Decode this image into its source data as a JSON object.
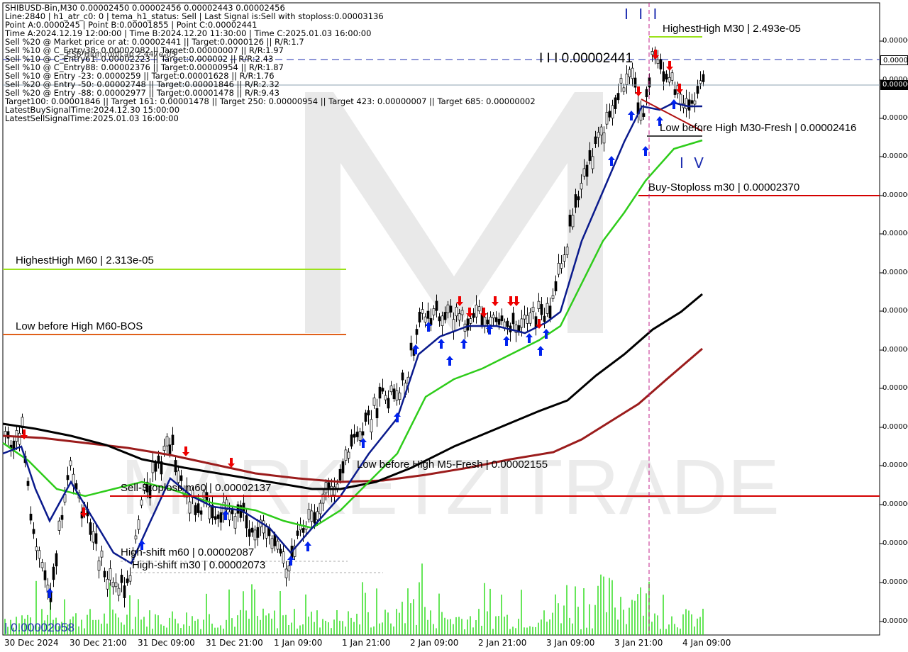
{
  "header": {
    "symbol_line": "SHIBUSD-Bin,M30  0.00002450 0.00002456 0.00002443 0.00002456",
    "info_lines": [
      "Line:2840 | h1_atr_c0: 0 | tema_h1_status: Sell | Last Signal is:Sell with stoploss:0.00003136",
      "Point A:0.0000245 | Point B:0.00001855 | Point C:0.00002441",
      "Time A:2024.12.19 12:00:00 | Time B:2024.12.20 11:30:00 | Time C:2025.01.03 16:00:00",
      "Sell %20 @ Market price or at: 0.00002441 || Target:0.0000126 || R/R:1.7",
      "Sell %10 @ C_Entry38: 0.00002082 || Target:0.00000007 || R/R:1.97",
      "Sell %10 @ C_Entry61: 0.00002223 || Target:0.000002 || R/R:2.43",
      "Sell %10 @ C_Entry88: 0.00002376 || Target:0.00000954 || R/R:1.87",
      "Sell %10 @ Entry -23: 0.0000259 || Target:0.00001628 || R/R:1.76",
      "Sell %20 @ Entry -50: 0.00002748 || Target:0.00001846 || R/R:2.32",
      "Sell %20 @ Entry -88: 0.00002977 || Target:0.00001478 || R/R:9.43",
      "Target100: 0.00001846 || Target 161: 0.00001478 || Target 250: 0.00000954 || Target 423: 0.00000007 || Target 685: 0.00000002",
      "LatestBuySignalTime:2024.12.30 15:00:00",
      "LatestSellSignalTime:2025.01.03 16:00:00"
    ],
    "overlap_label": "_ESB High roofcap 2.447e-05"
  },
  "levels": {
    "highest_high_m30": "HighestHigh   M30 | 2.493e-05",
    "point_c": "I I I 0.00002441",
    "low_before_high_m30": "Low before High   M30-Fresh | 0.00002416",
    "buy_stoploss": "Buy-Stoploss m30 | 0.00002370",
    "highest_high_m60": "HighestHigh   M60 | 2.313e-05",
    "low_before_high_m60": "Low before High   M60-BOS",
    "low_before_high_m5": "Low before High   M5-Fresh | 0.00002155",
    "sell_stoploss": "Sell-Stoploss m60 | 0.00002137",
    "high_shift_m60": "High-shift m60 | 0.00002087",
    "high_shift_m30": "High-shift m30 | 0.00002073",
    "bottom_value": "| 0.00002058"
  },
  "waves": {
    "w3": "I I I",
    "w4": "I V"
  },
  "watermark": {
    "text": "MARKETZITRADE"
  },
  "price_axis": {
    "labels": [
      "0.00000",
      "0.00000",
      "0.00000",
      "0.00000",
      "0.00000",
      "0.00000",
      "0.00000",
      "0.00000",
      "0.00000",
      "0.00000",
      "0.00000",
      "0.00000",
      "0.00000",
      "0.00000",
      "0.00000",
      "0.00000",
      "0.00000"
    ],
    "current_label": "0.00000",
    "dashed_label": "0.00000"
  },
  "time_axis": {
    "labels": [
      "30 Dec 2024",
      "30 Dec 21:00",
      "31 Dec 09:00",
      "31 Dec 21:00",
      "1 Jan 09:00",
      "1 Jan 21:00",
      "2 Jan 09:00",
      "2 Jan 21:00",
      "3 Jan 09:00",
      "3 Jan 21:00",
      "4 Jan 09:00"
    ]
  },
  "colors": {
    "ema_fast": "#0a1a8c",
    "ema_mid": "#2ecc1a",
    "ema_slow": "#000000",
    "ema_long": "#9b1c1c",
    "highest_high": "#9be21a",
    "stoploss_red": "#d40000",
    "volume": "#33dd22",
    "buy_arrow": "#0022ee",
    "sell_arrow": "#ee0000"
  }
}
